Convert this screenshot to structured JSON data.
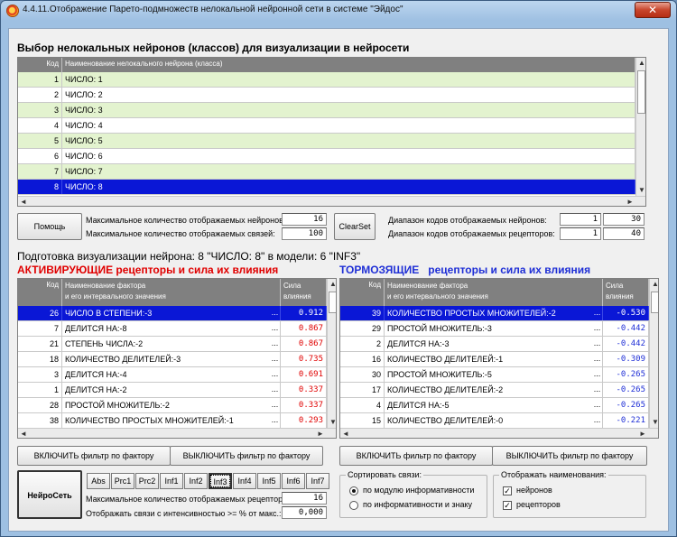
{
  "window": {
    "title": "4.4.11.Отображение Парето-подмножеств нелокальной нейронной сети в системе \"Эйдос\"",
    "close_glyph": "✕"
  },
  "neurons_section": {
    "heading": "Выбор нелокальных нейронов (классов) для визуализации в нейросети",
    "columns": [
      "Код",
      "Наименование нелокального нейрона (класса)"
    ],
    "rows": [
      {
        "code": "1",
        "name": "ЧИСЛО: 1"
      },
      {
        "code": "2",
        "name": "ЧИСЛО: 2"
      },
      {
        "code": "3",
        "name": "ЧИСЛО: 3"
      },
      {
        "code": "4",
        "name": "ЧИСЛО: 4"
      },
      {
        "code": "5",
        "name": "ЧИСЛО: 5"
      },
      {
        "code": "6",
        "name": "ЧИСЛО: 6"
      },
      {
        "code": "7",
        "name": "ЧИСЛО: 7"
      },
      {
        "code": "8",
        "name": "ЧИСЛО: 8"
      }
    ],
    "selected_index": 7
  },
  "controls": {
    "help_label": "Помощь",
    "max_neurons_label": "Максимальное количество отображаемых нейронов:",
    "max_neurons_value": "16",
    "max_links_label": "Максимальное количество отображаемых связей:",
    "max_links_value": "100",
    "clearset_label": "ClearSet",
    "neuron_range_label": "Диапазон кодов отображаемых нейронов:",
    "neuron_range_from": "1",
    "neuron_range_to": "30",
    "receptor_range_label": "Диапазон кодов отображаемых рецепторов:",
    "receptor_range_from": "1",
    "receptor_range_to": "40"
  },
  "prep_heading": "Подготовка визуализации нейрона: 8 \"ЧИСЛО: 8\" в модели: 6 \"INF3\"",
  "activating": {
    "heading": "АКТИВИРУЮЩИЕ рецепторы и сила их влияния",
    "col_code": "Код",
    "col_name_1": "Наименование фактора",
    "col_name_2": "и его интервального значения",
    "col_force_1": "Сила",
    "col_force_2": "влияния",
    "rows": [
      {
        "code": "26",
        "name": "ЧИСЛО В СТЕПЕНИ:-3",
        "force": "0.912"
      },
      {
        "code": "7",
        "name": "ДЕЛИТСЯ НА:-8",
        "force": "0.867"
      },
      {
        "code": "21",
        "name": "СТЕПЕНЬ ЧИСЛА:-2",
        "force": "0.867"
      },
      {
        "code": "18",
        "name": "КОЛИЧЕСТВО ДЕЛИТЕЛЕЙ:-3",
        "force": "0.735"
      },
      {
        "code": "3",
        "name": "ДЕЛИТСЯ НА:-4",
        "force": "0.691"
      },
      {
        "code": "1",
        "name": "ДЕЛИТСЯ НА:-2",
        "force": "0.337"
      },
      {
        "code": "28",
        "name": "ПРОСТОЙ МНОЖИТЕЛЬ:-2",
        "force": "0.337"
      },
      {
        "code": "38",
        "name": "КОЛИЧЕСТВО ПРОСТЫХ МНОЖИТЕЛЕЙ:-1",
        "force": "0.293"
      }
    ],
    "filter_on": "ВКЛЮЧИТЬ фильтр по фактору",
    "filter_off": "ВЫКЛЮЧИТЬ фильтр по фактору"
  },
  "inhibiting": {
    "heading_word": "ТОРМОЗЯЩИЕ",
    "heading_rest": "рецепторы и сила их влияния",
    "col_code": "Код",
    "col_name_1": "Наименование фактора",
    "col_name_2": "и его интервального значения",
    "col_force_1": "Сила",
    "col_force_2": "влияния",
    "rows": [
      {
        "code": "39",
        "name": "КОЛИЧЕСТВО ПРОСТЫХ МНОЖИТЕЛЕЙ:-2",
        "force": "-0.530"
      },
      {
        "code": "29",
        "name": "ПРОСТОЙ МНОЖИТЕЛЬ:-3",
        "force": "-0.442"
      },
      {
        "code": "2",
        "name": "ДЕЛИТСЯ НА:-3",
        "force": "-0.442"
      },
      {
        "code": "16",
        "name": "КОЛИЧЕСТВО ДЕЛИТЕЛЕЙ:-1",
        "force": "-0.309"
      },
      {
        "code": "30",
        "name": "ПРОСТОЙ МНОЖИТЕЛЬ:-5",
        "force": "-0.265"
      },
      {
        "code": "17",
        "name": "КОЛИЧЕСТВО ДЕЛИТЕЛЕЙ:-2",
        "force": "-0.265"
      },
      {
        "code": "4",
        "name": "ДЕЛИТСЯ НА:-5",
        "force": "-0.265"
      },
      {
        "code": "15",
        "name": "КОЛИЧЕСТВО ДЕЛИТЕЛЕЙ:-0",
        "force": "-0.221"
      }
    ],
    "filter_on": "ВКЛЮЧИТЬ фильтр по фактору",
    "filter_off": "ВЫКЛЮЧИТЬ фильтр по фактору"
  },
  "bottom": {
    "neuroset_label": "НейроСеть",
    "models": [
      "Abs",
      "Prc1",
      "Prc2",
      "Inf1",
      "Inf2",
      "Inf3",
      "Inf4",
      "Inf5",
      "Inf6",
      "Inf7"
    ],
    "active_model": "Inf3",
    "max_receptors_label": "Максимальное количество отображаемых рецепторов:",
    "max_receptors_value": "16",
    "intensity_label": "Отображать связи с интенсивностью >= % от макс.:",
    "intensity_value": "0,000",
    "sort_title": "Сортировать связи:",
    "sort_options": [
      "по модулю информативности",
      "по информативности и знаку"
    ],
    "sort_selected": 0,
    "show_title": "Отображать наименования:",
    "show_options": [
      "нейронов",
      "рецепторов"
    ],
    "check_mark": "✓"
  },
  "scroll": {
    "up": "▲",
    "down": "▼",
    "left": "◄",
    "right": "►"
  },
  "ellipsis": "..."
}
